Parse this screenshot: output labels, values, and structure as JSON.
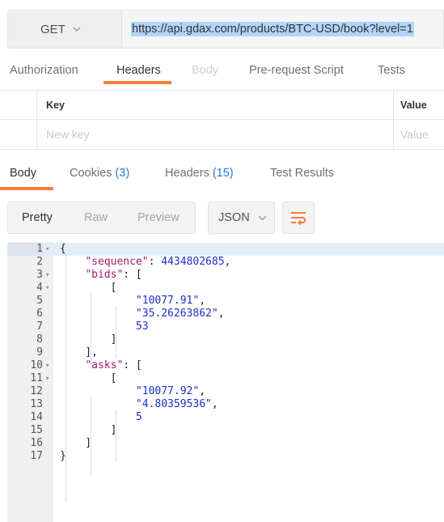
{
  "request": {
    "method": "GET",
    "url": "https://api.gdax.com/products/BTC-USD/book?level=1"
  },
  "request_tabs": {
    "authorization": "Authorization",
    "headers": "Headers",
    "body": "Body",
    "pre_request_script": "Pre-request Script",
    "tests": "Tests",
    "active": "Headers"
  },
  "headers_table": {
    "key_header": "Key",
    "value_header": "Value",
    "key_placeholder": "New key",
    "value_placeholder": "Value"
  },
  "response_tabs": {
    "body": "Body",
    "cookies": "Cookies",
    "cookies_count": "(3)",
    "headers": "Headers",
    "headers_count": "(15)",
    "test_results": "Test Results",
    "active": "Body"
  },
  "view_modes": {
    "pretty": "Pretty",
    "raw": "Raw",
    "preview": "Preview",
    "active": "Pretty"
  },
  "format": "JSON",
  "icons": {
    "method_dropdown": "chevron-down-icon",
    "format_dropdown": "chevron-down-icon",
    "wrap": "wrap-lines-icon"
  },
  "colors": {
    "accent": "#f37d3b",
    "count": "#2a7bd0",
    "json_key": "#a31776",
    "json_value": "#1c2fc6",
    "url_selection": "#b3d4fc"
  },
  "code_lines": [
    {
      "n": "1",
      "fold": true,
      "text": "{"
    },
    {
      "n": "2",
      "fold": false,
      "text": "    \"sequence\": 4434802685,"
    },
    {
      "n": "3",
      "fold": true,
      "text": "    \"bids\": ["
    },
    {
      "n": "4",
      "fold": true,
      "text": "        ["
    },
    {
      "n": "5",
      "fold": false,
      "text": "            \"10077.91\","
    },
    {
      "n": "6",
      "fold": false,
      "text": "            \"35.26263862\","
    },
    {
      "n": "7",
      "fold": false,
      "text": "            53"
    },
    {
      "n": "8",
      "fold": false,
      "text": "        ]"
    },
    {
      "n": "9",
      "fold": false,
      "text": "    ],"
    },
    {
      "n": "10",
      "fold": true,
      "text": "    \"asks\": ["
    },
    {
      "n": "11",
      "fold": true,
      "text": "        ["
    },
    {
      "n": "12",
      "fold": false,
      "text": "            \"10077.92\","
    },
    {
      "n": "13",
      "fold": false,
      "text": "            \"4.80359536\","
    },
    {
      "n": "14",
      "fold": false,
      "text": "            5"
    },
    {
      "n": "15",
      "fold": false,
      "text": "        ]"
    },
    {
      "n": "16",
      "fold": false,
      "text": "    ]"
    },
    {
      "n": "17",
      "fold": false,
      "text": "}"
    }
  ]
}
